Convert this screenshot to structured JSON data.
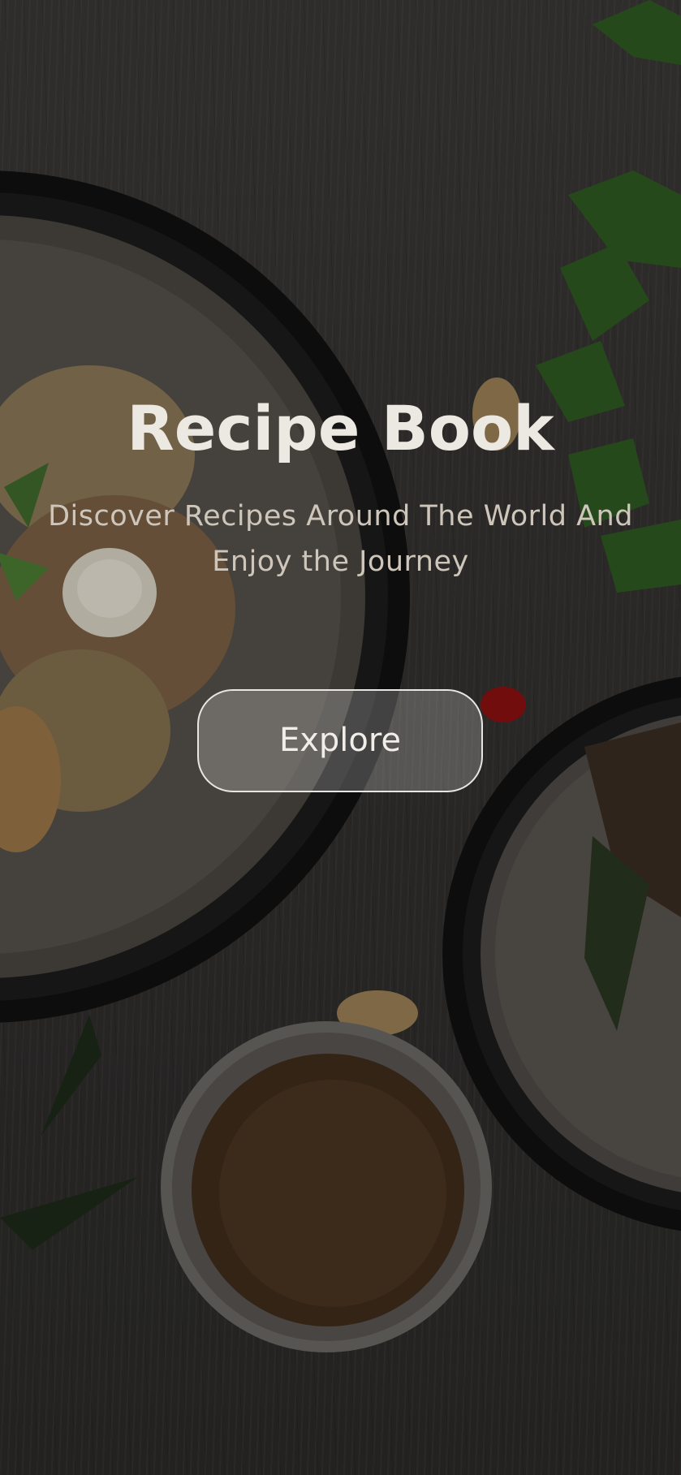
{
  "hero": {
    "title": "Recipe Book",
    "subtitle": "Discover Recipes Around The World And Enjoy the Journey"
  },
  "actions": {
    "explore_label": "Explore"
  },
  "colors": {
    "title": "#ece8e2",
    "subtitle": "#cfc6bb",
    "button_border": "#e8e6e3",
    "background": "#33312f"
  }
}
